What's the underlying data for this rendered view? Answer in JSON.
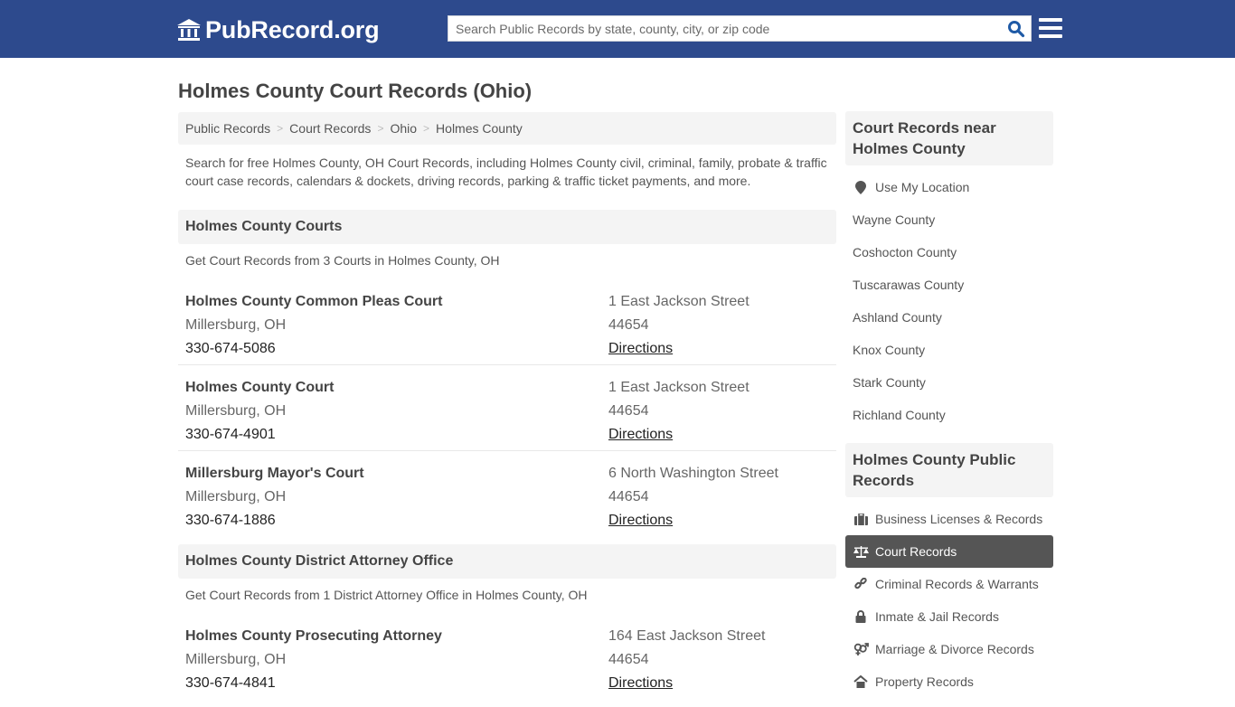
{
  "header": {
    "logo_text": "PubRecord.org",
    "logo_icon": "courthouse-icon",
    "search_placeholder": "Search Public Records by state, county, city, or zip code",
    "search_value": "",
    "search_icon": "search-icon",
    "menu_icon": "hamburger-menu-icon"
  },
  "colors": {
    "brand": "#2d4a8d",
    "search_icon": "#1f5aa6",
    "active_item_bg": "#555555",
    "panel_bg": "#f4f4f4"
  },
  "page": {
    "title": "Holmes County Court Records (Ohio)",
    "breadcrumb": [
      {
        "label": "Public Records"
      },
      {
        "label": "Court Records"
      },
      {
        "label": "Ohio"
      },
      {
        "label": "Holmes County"
      }
    ],
    "breadcrumb_separator": ">",
    "intro": "Search for free Holmes County, OH Court Records, including Holmes County civil, criminal, family, probate & traffic court case records, calendars & dockets, driving records, parking & traffic ticket payments, and more."
  },
  "sections": [
    {
      "title": "Holmes County Courts",
      "subtitle": "Get Court Records from 3 Courts in Holmes County, OH",
      "entries": [
        {
          "name": "Holmes County Common Pleas Court",
          "city": "Millersburg, OH",
          "phone": "330-674-5086",
          "address": "1 East Jackson Street",
          "zip": "44654",
          "directions": "Directions"
        },
        {
          "name": "Holmes County Court",
          "city": "Millersburg, OH",
          "phone": "330-674-4901",
          "address": "1 East Jackson Street",
          "zip": "44654",
          "directions": "Directions"
        },
        {
          "name": "Millersburg Mayor's Court",
          "city": "Millersburg, OH",
          "phone": "330-674-1886",
          "address": "6 North Washington Street",
          "zip": "44654",
          "directions": "Directions"
        }
      ]
    },
    {
      "title": "Holmes County District Attorney Office",
      "subtitle": "Get Court Records from 1 District Attorney Office in Holmes County, OH",
      "entries": [
        {
          "name": "Holmes County Prosecuting Attorney",
          "city": "Millersburg, OH",
          "phone": "330-674-4841",
          "address": "164 East Jackson Street",
          "zip": "44654",
          "directions": "Directions"
        }
      ]
    }
  ],
  "sidebar": {
    "nearby": {
      "title": "Court Records near Holmes County",
      "use_location": {
        "label": "Use My Location",
        "icon": "map-marker-icon"
      },
      "items": [
        {
          "label": "Wayne County"
        },
        {
          "label": "Coshocton County"
        },
        {
          "label": "Tuscarawas County"
        },
        {
          "label": "Ashland County"
        },
        {
          "label": "Knox County"
        },
        {
          "label": "Stark County"
        },
        {
          "label": "Richland County"
        }
      ]
    },
    "public_records": {
      "title": "Holmes County Public Records",
      "items": [
        {
          "label": "Business Licenses & Records",
          "icon": "briefcase-icon",
          "active": false
        },
        {
          "label": "Court Records",
          "icon": "scales-icon",
          "active": true
        },
        {
          "label": "Criminal Records & Warrants",
          "icon": "link-icon",
          "active": false
        },
        {
          "label": "Inmate & Jail Records",
          "icon": "lock-icon",
          "active": false
        },
        {
          "label": "Marriage & Divorce Records",
          "icon": "gender-icon",
          "active": false
        },
        {
          "label": "Property Records",
          "icon": "house-icon",
          "active": false
        }
      ]
    }
  }
}
